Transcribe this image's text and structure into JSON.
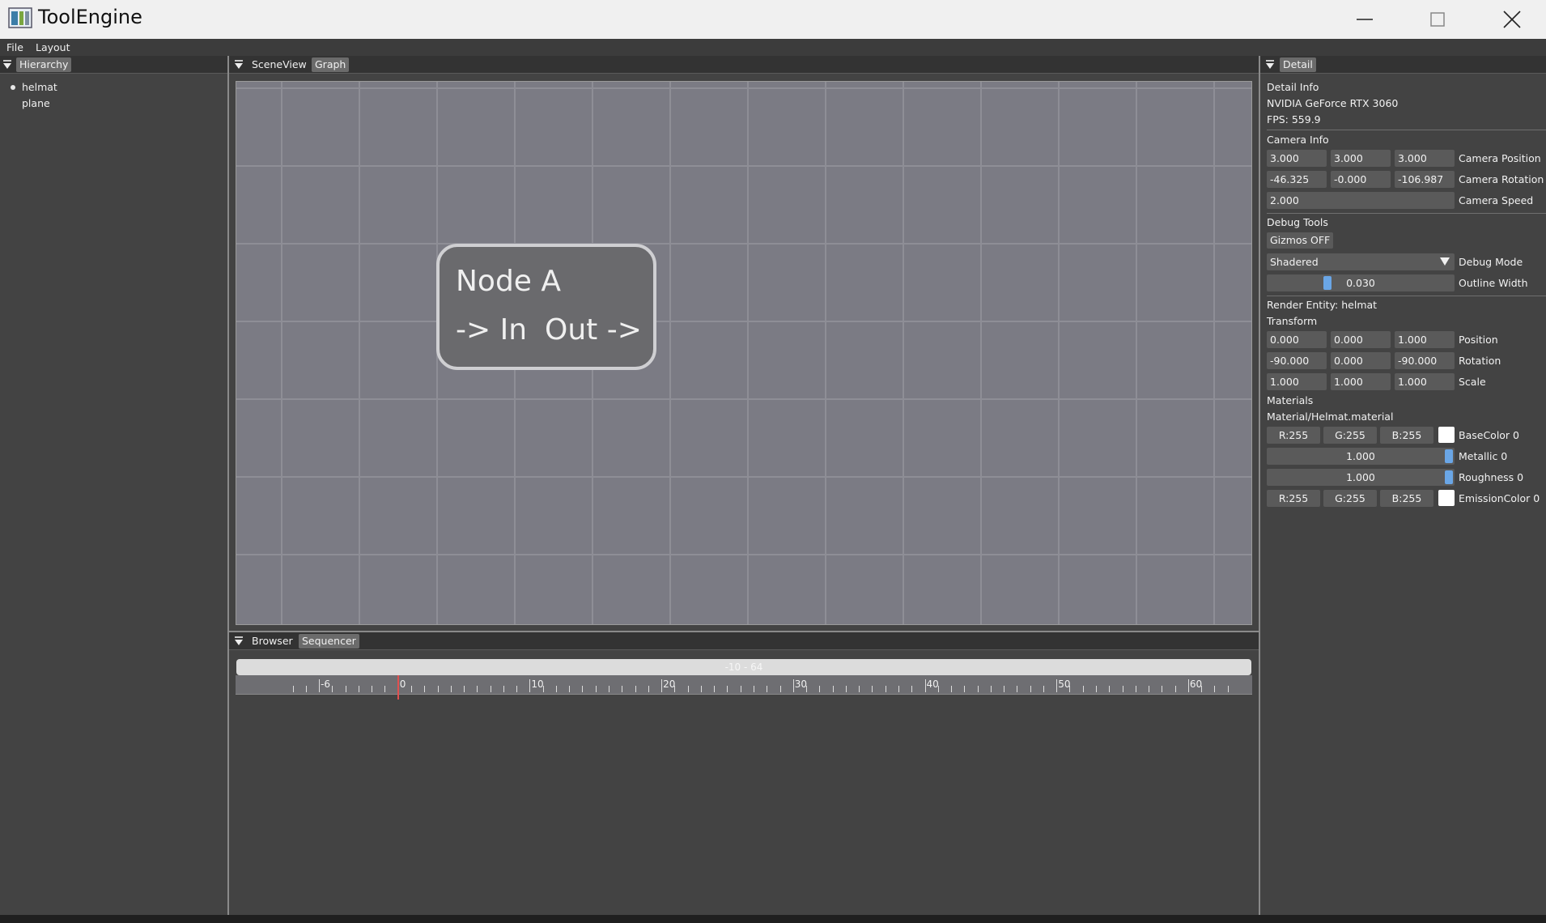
{
  "window": {
    "title": "ToolEngine"
  },
  "menu": [
    "File",
    "Layout"
  ],
  "hierarchy": {
    "tab": "Hierarchy",
    "items": [
      "helmat",
      "plane"
    ]
  },
  "center": {
    "tabs": [
      "SceneView",
      "Graph"
    ],
    "node": {
      "title": "Node A",
      "input": "-> In",
      "output": "Out ->"
    }
  },
  "bottom": {
    "tabs": [
      "Browser",
      "Sequencer"
    ],
    "range_label": "-10 - 64",
    "tick_labels": [
      "-6",
      "0",
      "10",
      "20",
      "30",
      "40",
      "50",
      "60"
    ]
  },
  "detail": {
    "tab": "Detail",
    "detail_info_heading": "Detail Info",
    "gpu": "NVIDIA GeForce RTX 3060",
    "fps": "FPS: 559.9",
    "camera_info_heading": "Camera Info",
    "camera_position": {
      "values": [
        "3.000",
        "3.000",
        "3.000"
      ],
      "label": "Camera Position"
    },
    "camera_rotation": {
      "values": [
        "-46.325",
        "-0.000",
        "-106.987"
      ],
      "label": "Camera Rotation"
    },
    "camera_speed": {
      "value": "2.000",
      "label": "Camera Speed"
    },
    "debug_tools_heading": "Debug Tools",
    "gizmos_button": "Gizmos OFF",
    "debug_mode": {
      "value": "Shadered",
      "label": "Debug Mode"
    },
    "outline_width": {
      "value": "0.030",
      "label": "Outline Width",
      "level": 0.03
    },
    "render_entity": "Render Entity: helmat",
    "transform_heading": "Transform",
    "position": {
      "values": [
        "0.000",
        "0.000",
        "1.000"
      ],
      "label": "Position"
    },
    "rotation": {
      "values": [
        "-90.000",
        "0.000",
        "-90.000"
      ],
      "label": "Rotation"
    },
    "scale": {
      "values": [
        "1.000",
        "1.000",
        "1.000"
      ],
      "label": "Scale"
    },
    "materials_heading": "Materials",
    "material_path": "Material/Helmat.material",
    "base_color": {
      "values": [
        "R:255",
        "G:255",
        "B:255"
      ],
      "label": "BaseColor 0",
      "swatch": "#ffffff"
    },
    "metallic": {
      "value": "1.000",
      "label": "Metallic 0",
      "level": 1.0
    },
    "roughness": {
      "value": "1.000",
      "label": "Roughness 0",
      "level": 1.0
    },
    "emission_color": {
      "values": [
        "R:255",
        "G:255",
        "B:255"
      ],
      "label": "EmissionColor 0",
      "swatch": "#ffffff"
    }
  },
  "colors": {
    "accent": "#6aa6e6",
    "playhead": "#e05050",
    "panel": "#434343",
    "scene": "#7b7b84"
  }
}
